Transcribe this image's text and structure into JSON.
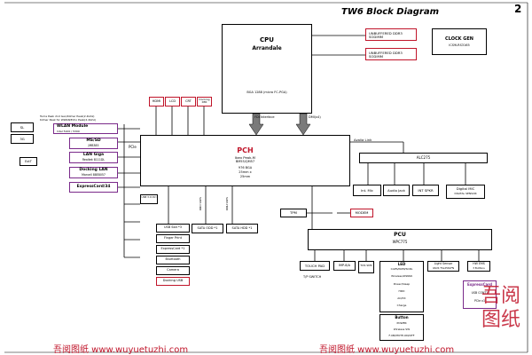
{
  "title": "TW6 Block Diagram",
  "page_number": "2",
  "cpu": {
    "title": "CPU",
    "subtitle": "Arrandale",
    "note": "BGA 1288 (micro FC-PGA)"
  },
  "dimm": [
    {
      "label": "UNBUFFERED DDR3 SODIMM"
    },
    {
      "label": "UNBUFFERED DDR3 SODIMM"
    }
  ],
  "clock": {
    "label": "CLOCK GEN",
    "sub": "ICS9LRS3165"
  },
  "top_small": [
    "HDMI",
    "LCD",
    "CRT",
    "Docking DMI"
  ],
  "fdi_label": "FDI Interface",
  "dmi_label": "DMI(x4)",
  "left_blocks": [
    {
      "name": "WLAN Module",
      "sub": "Intel 5100 / 5300"
    },
    {
      "name": "MS/SD",
      "sub": "JMB385"
    },
    {
      "name": "LAN Giga",
      "sub": "Realtek 8111DL"
    },
    {
      "name": "Docking LAN",
      "sub": "Marvell 88E8057"
    },
    {
      "name": "ExpressCard/34",
      "sub": ""
    }
  ],
  "left_small": [
    "SL",
    "3G",
    "ExtT"
  ],
  "left_note": "Tuma Peak 2nd Gen/Kilmer Peak(2.4Ghz)\nKilmer Peak for WWAN/Echo Peak(2.4Ghz)",
  "pcie_label": "PCIe",
  "pch": {
    "title": "PCH",
    "subtitle": "Ibex Peak-M",
    "line2": "BM55/QM57",
    "line3": "976 BGA",
    "line4": "25mm x",
    "line5": "25mm"
  },
  "azalia_label": "Azalia Link",
  "alc": "ALC275",
  "audio": [
    "Int. Mic",
    "Audio Jack",
    "INT SPKR",
    "Digital MIC"
  ],
  "digital_mic_sub": "DIGITAL SENSOR",
  "usb_box": "USB 3.0 Ctrl",
  "sata_labels": [
    "SATA ODD",
    "SATA HDD"
  ],
  "usb_items": [
    "USB Slot *3",
    "Finger Print",
    "ExpressCard *1",
    "Bluetooth",
    "Camera",
    "Docking USB"
  ],
  "sata_boxes": [
    "SATA ODD *1",
    "SATA HDD *1"
  ],
  "tpm_label": "TPM",
  "modem_label": "MODEM",
  "pcu": {
    "title": "PCU",
    "subtitle": "WPC775"
  },
  "bottom_items": [
    "TOUCH PAD",
    "IMP-8/A",
    "TOS SMS",
    "LED",
    "Light Sensor",
    "HW EMS"
  ],
  "tp_sub": "T/P SWITCH",
  "led_lines": [
    "CAPS/NUM/SCRL",
    "Wireless/WWAN",
    "Power/Sleep",
    "HDD",
    "AC/DC",
    "Charge"
  ],
  "light_sub": "VAOS TSL2561FN",
  "hw_sub": "3 Buttons",
  "express_card": {
    "title": "ExpressCard",
    "line1": "USB CONT1",
    "line2": "PCIe x1"
  },
  "button_box": {
    "title": "Button",
    "line1": "POWER",
    "line2": "Wireless SW",
    "line3": "F-KB/MUTE-ON/OFF"
  },
  "watermark": [
    "吾阅图纸 www.wuyuetuzhi.com",
    "吾阅图纸 www.wuyuetuzhi.com"
  ],
  "seal_chars": [
    "吾",
    "阅",
    "图",
    "纸"
  ],
  "colors": {
    "red": "#c0152a",
    "purple": "#7a2a8a",
    "arrow_fill": "#7a7a7a"
  }
}
